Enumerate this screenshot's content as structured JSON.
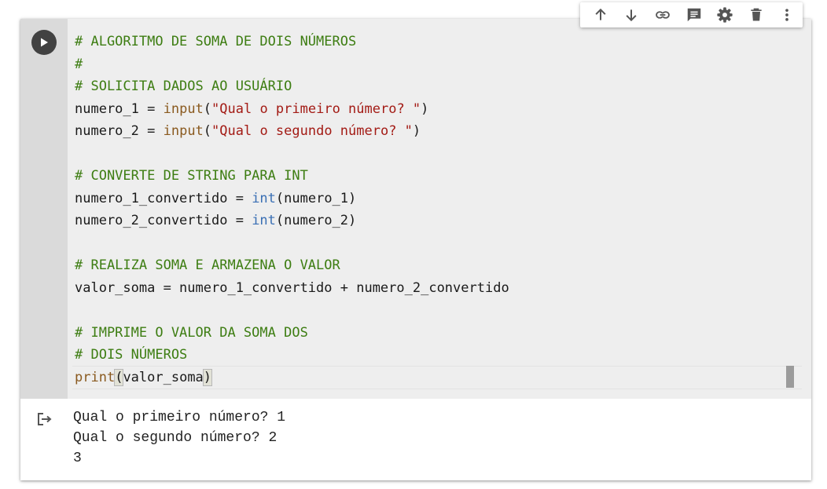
{
  "toolbar": {
    "buttons": [
      {
        "icon": "arrow-up-icon"
      },
      {
        "icon": "arrow-down-icon"
      },
      {
        "icon": "link-icon"
      },
      {
        "icon": "comment-icon"
      },
      {
        "icon": "gear-icon"
      },
      {
        "icon": "trash-icon"
      },
      {
        "icon": "more-vert-icon"
      }
    ]
  },
  "cell": {
    "run_icon": "play-icon",
    "code": {
      "l1": "# ALGORITMO DE SOMA DE DOIS NÚMEROS",
      "l2": "#",
      "l3": "# SOLICITA DADOS AO USUÁRIO",
      "l4_var": "numero_1",
      "l4_op": " = ",
      "l4_fn": "input",
      "l4_open": "(",
      "l4_str": "\"Qual o primeiro número? \"",
      "l4_close": ")",
      "l5_var": "numero_2",
      "l5_op": " = ",
      "l5_fn": "input",
      "l5_open": "(",
      "l5_str": "\"Qual o segundo número? \"",
      "l5_close": ")",
      "l7": "# CONVERTE DE STRING PARA INT",
      "l8_var": "numero_1_convertido",
      "l8_op": " = ",
      "l8_fn": "int",
      "l8_args": "(numero_1)",
      "l9_var": "numero_2_convertido",
      "l9_op": " = ",
      "l9_fn": "int",
      "l9_args": "(numero_2)",
      "l11": "# REALIZA SOMA E ARMAZENA O VALOR",
      "l12": "valor_soma = numero_1_convertido + numero_2_convertido",
      "l14": "# IMPRIME O VALOR DA SOMA DOS",
      "l15": "# DOIS NÚMEROS",
      "l16_fn": "print",
      "l16_open": "(",
      "l16_arg": "valor_soma",
      "l16_close": ")"
    }
  },
  "output": {
    "icon": "output-arrow-icon",
    "lines": [
      "Qual o primeiro número? 1",
      "Qual o segundo número? 2",
      "3"
    ]
  },
  "colors": {
    "comment": "#3d7d12",
    "string": "#a31b15",
    "builtin": "#8a5a1f",
    "type": "#3a6fb4",
    "editor_bg": "#eeeeee",
    "gutter_bg": "#dadada"
  }
}
